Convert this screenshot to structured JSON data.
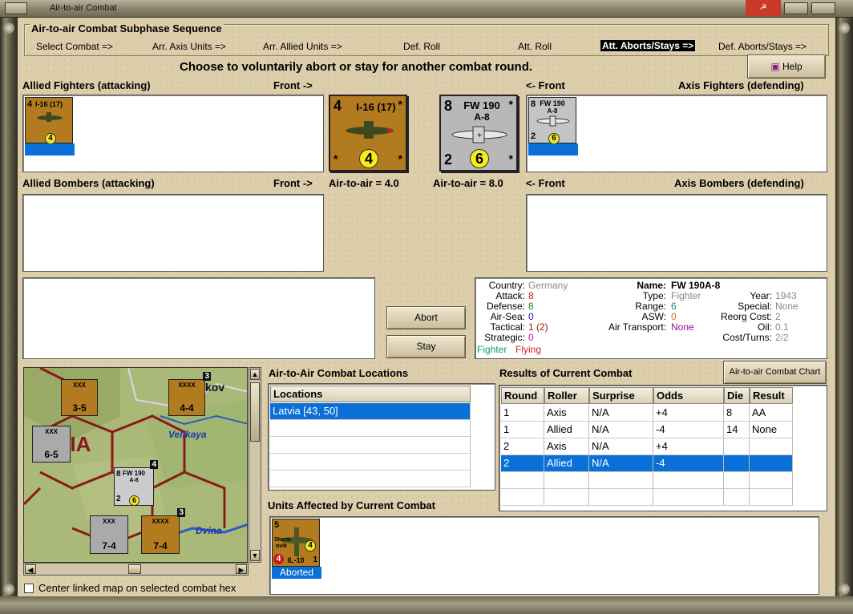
{
  "window": {
    "title": "Air-to-air Combat"
  },
  "subphase": {
    "title": "Air-to-air Combat Subphase Sequence",
    "steps": [
      "Select Combat =>",
      "Arr. Axis Units =>",
      "Arr. Allied Units =>",
      "Def. Roll",
      "Att. Roll",
      "Att. Aborts/Stays =>",
      "Def. Aborts/Stays =>"
    ],
    "active_index": 5
  },
  "instruction": "Choose to voluntarily abort or stay for another combat round.",
  "help_label": "Help",
  "sections": {
    "allied_fighters": "Allied Fighters (attacking)",
    "front_right": "Front ->",
    "front_left": "<- Front",
    "axis_fighters": "Axis Fighters (defending)",
    "allied_bombers": "Allied Bombers (attacking)",
    "axis_bombers": "Axis Bombers (defending)",
    "allied_air_to_air": "Air-to-air = 4.0",
    "axis_air_to_air": "Air-to-air = 8.0"
  },
  "allied_counter": {
    "name": "I-16 (17)",
    "attack": "4",
    "rating": "4",
    "corner": "*"
  },
  "axis_counter": {
    "name_line1": "FW 190",
    "name_line2": "A-8",
    "attack": "8",
    "defense": "2",
    "rating": "6",
    "corner": "*"
  },
  "buttons": {
    "abort": "Abort",
    "stay": "Stay",
    "chart": "Air-to-air Combat Chart"
  },
  "unit_info": {
    "country_label": "Country:",
    "country": "Germany",
    "attack_label": "Attack:",
    "attack": "8",
    "defense_label": "Defense:",
    "defense": "8",
    "airsea_label": "Air-Sea:",
    "airsea": "0",
    "tactical_label": "Tactical:",
    "tactical": "1 (2)",
    "strategic_label": "Strategic:",
    "strategic": "0",
    "role_fighter": "Fighter",
    "role_flying": "Flying",
    "name_label": "Name:",
    "name": "FW 190A-8",
    "type_label": "Type:",
    "type": "Fighter",
    "range_label": "Range:",
    "range": "6",
    "asw_label": "ASW:",
    "asw": "0",
    "airtransport_label": "Air Transport:",
    "airtransport": "None",
    "year_label": "Year:",
    "year": "1943",
    "special_label": "Special:",
    "special": "None",
    "reorg_label": "Reorg Cost:",
    "reorg": "2",
    "oil_label": "Oil:",
    "oil": "0.1",
    "cost_label": "Cost/Turns:",
    "cost": "2/2"
  },
  "locations": {
    "title": "Air-to-Air Combat Locations",
    "header": "Locations",
    "rows": [
      "Latvia [43, 50]"
    ]
  },
  "results": {
    "title": "Results of Current Combat",
    "columns": [
      "Round",
      "Roller",
      "Surprise",
      "Odds",
      "Die",
      "Result"
    ],
    "rows": [
      [
        "1",
        "Axis",
        "N/A",
        "+4",
        "8",
        "AA"
      ],
      [
        "1",
        "Allied",
        "N/A",
        "-4",
        "14",
        "None"
      ],
      [
        "2",
        "Axis",
        "N/A",
        "+4",
        "",
        ""
      ],
      [
        "2",
        "Allied",
        "N/A",
        "-4",
        "",
        ""
      ]
    ],
    "selected_row": 3
  },
  "affected": {
    "title": "Units Affected by Current Combat",
    "unit": {
      "top": "5",
      "name_line1": "Sturm-",
      "name_line2": "ovik",
      "model": "IL-10",
      "rating": "4",
      "red": "4",
      "right": "1",
      "status": "Aborted"
    }
  },
  "map": {
    "labels": [
      "VIA",
      "Velikaya",
      "Dvina",
      "kov"
    ],
    "counters": [
      {
        "top": "XXX",
        "value": "3-5"
      },
      {
        "top": "XXXX",
        "value": "4-4",
        "badge": "3"
      },
      {
        "top": "XXX",
        "value": "6-5"
      },
      {
        "top": "XXX",
        "value": "7-4"
      },
      {
        "top": "XXXX",
        "value": "7-4",
        "badge": "3"
      }
    ],
    "fighter": {
      "attack": "8",
      "name": "FW 190",
      "model": "A-8",
      "defense": "2",
      "rating": "6",
      "badge": "4"
    }
  },
  "center_checkbox": "Center linked map on selected combat hex"
}
